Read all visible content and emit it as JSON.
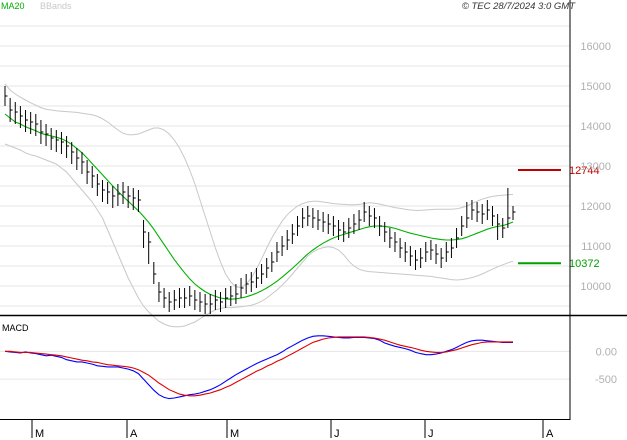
{
  "header": {
    "legend_ma": "MA20",
    "legend_bb": "BBands",
    "copyright": "© TEC 28/7/2024 3:0 GMT"
  },
  "colors": {
    "ma": "#00b000",
    "bands": "#c8c8c8",
    "bars": "#000000",
    "macd": "#0000ff",
    "signal": "#e00000",
    "resistance": "#c00000",
    "support": "#00a000",
    "grid": "#e6e6e6",
    "axis_text": "#b0b0b0"
  },
  "chart_data": [
    {
      "type": "ohlc",
      "y_ticks": [
        10000,
        11000,
        12000,
        13000,
        14000,
        15000,
        16000
      ],
      "y_tick_labels": [
        "10000",
        "11000",
        "12000",
        "13000",
        "14000",
        "15000",
        "16000"
      ],
      "ylim": [
        9300,
        16800
      ],
      "x_ticks": [
        "M",
        "A",
        "M",
        "J",
        "J",
        "A"
      ],
      "levels": [
        {
          "label": "12744",
          "value": 12900,
          "kind": "resistance"
        },
        {
          "label": "10372",
          "value": 10570,
          "kind": "support"
        }
      ],
      "close": [
        14750,
        14400,
        14350,
        14250,
        14150,
        14100,
        14050,
        13850,
        13800,
        13700,
        13650,
        13600,
        13500,
        13350,
        13200,
        13100,
        12850,
        12750,
        12550,
        12400,
        12350,
        12250,
        12300,
        12350,
        12250,
        12200,
        12150,
        11350,
        11100,
        10300,
        9850,
        9700,
        9600,
        9650,
        9700,
        9700,
        9750,
        9650,
        9600,
        9550,
        9550,
        9650,
        9600,
        9700,
        9750,
        9800,
        9950,
        10050,
        10100,
        10200,
        10300,
        10450,
        10600,
        10850,
        11000,
        11150,
        11300,
        11500,
        11700,
        11750,
        11700,
        11650,
        11600,
        11550,
        11500,
        11400,
        11350,
        11450,
        11550,
        11650,
        11850,
        11750,
        11700,
        11500,
        11350,
        11200,
        11100,
        10950,
        10850,
        10750,
        10650,
        10700,
        10850,
        10900,
        10800,
        10700,
        10850,
        10950,
        11200,
        11500,
        11700,
        11900,
        11850,
        11800,
        11900,
        11750,
        11550,
        11450,
        11700,
        11850
      ],
      "high": [
        15000,
        14700,
        14600,
        14500,
        14400,
        14350,
        14300,
        14150,
        14050,
        13950,
        13900,
        13850,
        13750,
        13600,
        13450,
        13350,
        13150,
        13000,
        12800,
        12650,
        12600,
        12500,
        12550,
        12600,
        12500,
        12450,
        12400,
        11650,
        11350,
        10600,
        10100,
        9950,
        9850,
        9900,
        9950,
        9950,
        10000,
        9900,
        9850,
        9800,
        9800,
        9900,
        9850,
        9950,
        10000,
        10050,
        10200,
        10300,
        10350,
        10450,
        10550,
        10700,
        10850,
        11100,
        11250,
        11400,
        11550,
        11750,
        11950,
        12000,
        11950,
        11900,
        11850,
        11800,
        11750,
        11650,
        11600,
        11700,
        11800,
        11900,
        12100,
        12000,
        11950,
        11750,
        11600,
        11450,
        11350,
        11200,
        11100,
        11000,
        10900,
        10950,
        11100,
        11150,
        11050,
        10950,
        11100,
        11200,
        11450,
        11750,
        12100,
        12150,
        12100,
        12050,
        12150,
        12000,
        11800,
        11700,
        12450,
        12000
      ],
      "low": [
        14500,
        14100,
        14050,
        13950,
        13850,
        13800,
        13750,
        13550,
        13500,
        13400,
        13350,
        13300,
        13200,
        13050,
        12900,
        12800,
        12550,
        12450,
        12250,
        12100,
        12050,
        11950,
        12000,
        12050,
        11950,
        11900,
        11850,
        10950,
        10550,
        10050,
        9600,
        9450,
        9350,
        9400,
        9450,
        9450,
        9500,
        9400,
        9350,
        9300,
        9300,
        9400,
        9350,
        9450,
        9500,
        9550,
        9700,
        9800,
        9850,
        9950,
        10050,
        10200,
        10350,
        10600,
        10750,
        10900,
        11050,
        11250,
        11450,
        11500,
        11450,
        11400,
        11350,
        11300,
        11250,
        11150,
        11100,
        11200,
        11300,
        11400,
        11600,
        11500,
        11450,
        11250,
        11100,
        10950,
        10850,
        10700,
        10600,
        10500,
        10400,
        10450,
        10600,
        10650,
        10550,
        10450,
        10600,
        10700,
        10950,
        11250,
        11450,
        11650,
        11600,
        11550,
        11650,
        11500,
        11150,
        11200,
        11450,
        11650
      ],
      "ma20": [
        14300,
        14200,
        14100,
        14050,
        13980,
        13930,
        13880,
        13820,
        13780,
        13750,
        13720,
        13680,
        13620,
        13540,
        13440,
        13330,
        13200,
        13060,
        12920,
        12780,
        12640,
        12500,
        12370,
        12240,
        12120,
        12000,
        11880,
        11740,
        11590,
        11420,
        11230,
        11040,
        10850,
        10660,
        10490,
        10330,
        10180,
        10050,
        9950,
        9860,
        9790,
        9740,
        9700,
        9680,
        9670,
        9680,
        9700,
        9730,
        9770,
        9820,
        9880,
        9950,
        10030,
        10120,
        10220,
        10330,
        10440,
        10560,
        10680,
        10800,
        10900,
        10990,
        11070,
        11140,
        11200,
        11250,
        11290,
        11330,
        11370,
        11410,
        11450,
        11480,
        11500,
        11500,
        11490,
        11470,
        11440,
        11400,
        11360,
        11320,
        11290,
        11260,
        11230,
        11200,
        11180,
        11160,
        11150,
        11150,
        11160,
        11180,
        11220,
        11270,
        11320,
        11370,
        11420,
        11460,
        11490,
        11510,
        11550,
        11600
      ],
      "bb_upper": [
        15050,
        14900,
        14800,
        14720,
        14650,
        14580,
        14520,
        14460,
        14420,
        14400,
        14380,
        14370,
        14360,
        14350,
        14340,
        14320,
        14300,
        14280,
        14240,
        14180,
        14100,
        14000,
        13900,
        13820,
        13780,
        13780,
        13800,
        13850,
        13900,
        13950,
        13950,
        13900,
        13800,
        13650,
        13450,
        13200,
        12900,
        12550,
        12150,
        11750,
        11350,
        10950,
        10600,
        10300,
        10100,
        9980,
        9960,
        10050,
        10200,
        10420,
        10680,
        10950,
        11200,
        11420,
        11620,
        11780,
        11900,
        12000,
        12060,
        12100,
        12120,
        12120,
        12100,
        12080,
        12060,
        12050,
        12040,
        12030,
        12030,
        12040,
        12060,
        12080,
        12070,
        12050,
        12020,
        11990,
        11960,
        11940,
        11920,
        11900,
        11890,
        11890,
        11900,
        11910,
        11920,
        11920,
        11920,
        11920,
        11930,
        11960,
        12000,
        12060,
        12120,
        12170,
        12210,
        12240,
        12260,
        12270,
        12280,
        12290
      ],
      "bb_lower": [
        13550,
        13500,
        13450,
        13400,
        13330,
        13280,
        13250,
        13200,
        13150,
        13100,
        13050,
        12950,
        12850,
        12700,
        12550,
        12400,
        12250,
        12100,
        11900,
        11700,
        11400,
        11100,
        10800,
        10500,
        10200,
        9950,
        9700,
        9500,
        9350,
        9230,
        9120,
        9050,
        9000,
        8980,
        8980,
        9000,
        9050,
        9100,
        9180,
        9260,
        9340,
        9400,
        9440,
        9460,
        9460,
        9470,
        9480,
        9500,
        9520,
        9560,
        9620,
        9700,
        9800,
        9900,
        10020,
        10150,
        10300,
        10450,
        10600,
        10750,
        10850,
        10920,
        10960,
        10980,
        10960,
        10900,
        10780,
        10620,
        10500,
        10420,
        10380,
        10360,
        10350,
        10340,
        10330,
        10320,
        10310,
        10300,
        10290,
        10280,
        10270,
        10260,
        10250,
        10240,
        10220,
        10200,
        10180,
        10160,
        10150,
        10160,
        10180,
        10210,
        10250,
        10300,
        10360,
        10420,
        10480,
        10530,
        10580,
        10620
      ]
    },
    {
      "type": "line",
      "title": "MACD",
      "y_ticks": [
        0,
        -500
      ],
      "y_tick_labels": [
        "0.00",
        "-500"
      ],
      "ylim": [
        -1200,
        600
      ],
      "series": [
        {
          "values": [
            0,
            -10,
            -20,
            -30,
            -10,
            -30,
            -40,
            -60,
            -80,
            -70,
            -90,
            -110,
            -150,
            -170,
            -190,
            -190,
            -210,
            -230,
            -260,
            -270,
            -280,
            -280,
            -280,
            -300,
            -320,
            -350,
            -400,
            -500,
            -600,
            -700,
            -780,
            -830,
            -850,
            -840,
            -820,
            -800,
            -780,
            -770,
            -750,
            -720,
            -690,
            -650,
            -600,
            -540,
            -480,
            -420,
            -370,
            -320,
            -270,
            -220,
            -180,
            -140,
            -100,
            -60,
            -10,
            50,
            100,
            150,
            200,
            240,
            270,
            280,
            280,
            270,
            260,
            250,
            240,
            240,
            250,
            250,
            250,
            240,
            230,
            200,
            150,
            120,
            90,
            70,
            50,
            20,
            -20,
            -40,
            -60,
            -60,
            -50,
            -30,
            0,
            30,
            70,
            120,
            160,
            190,
            200,
            200,
            190,
            180,
            170,
            160,
            160,
            160
          ]
        },
        {
          "values": [
            0,
            0,
            -10,
            -20,
            -20,
            -20,
            -30,
            -40,
            -50,
            -60,
            -70,
            -80,
            -100,
            -120,
            -140,
            -160,
            -170,
            -190,
            -200,
            -220,
            -240,
            -250,
            -260,
            -270,
            -280,
            -300,
            -330,
            -380,
            -430,
            -500,
            -570,
            -630,
            -690,
            -730,
            -770,
            -790,
            -800,
            -800,
            -790,
            -770,
            -750,
            -720,
            -690,
            -650,
            -610,
            -560,
            -510,
            -460,
            -410,
            -360,
            -320,
            -270,
            -230,
            -180,
            -140,
            -90,
            -40,
            10,
            60,
            110,
            160,
            190,
            220,
            240,
            250,
            260,
            260,
            260,
            260,
            260,
            260,
            250,
            240,
            220,
            200,
            170,
            140,
            110,
            90,
            70,
            50,
            20,
            0,
            -10,
            -20,
            -20,
            -10,
            10,
            30,
            60,
            90,
            120,
            140,
            160,
            170,
            170,
            170,
            170,
            170,
            170
          ]
        }
      ]
    }
  ]
}
